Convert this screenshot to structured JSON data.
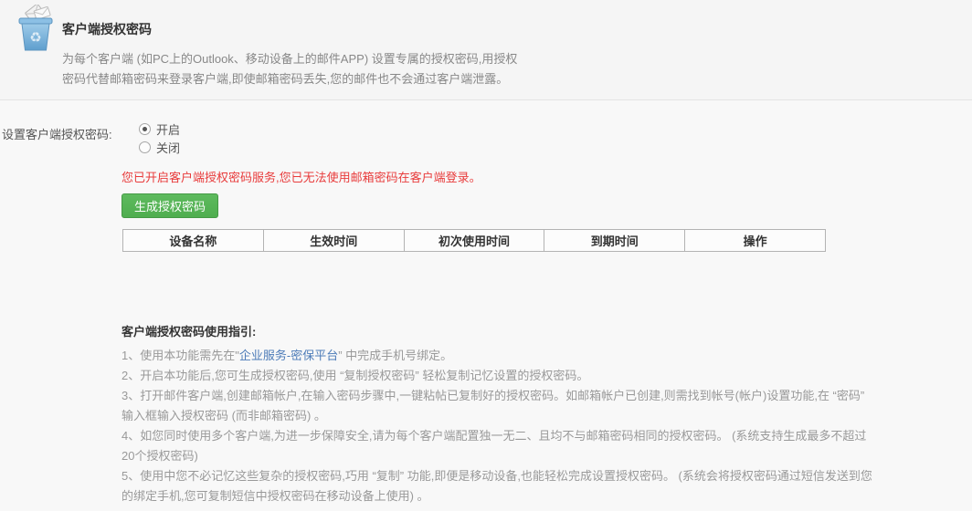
{
  "header": {
    "icon_name": "mail-trash-icon",
    "title": "客户端授权密码",
    "description_lines": [
      "为每个客户端 (如PC上的Outlook、移动设备上的邮件APP) 设置专属的授权密码,用授权",
      "密码代替邮箱密码来登录客户端,即使邮箱密码丢失,您的邮件也不会通过客户端泄露。"
    ]
  },
  "settings": {
    "label": "设置客户端授权密码:",
    "options": [
      {
        "label": "开启",
        "selected": true
      },
      {
        "label": "关闭",
        "selected": false
      }
    ],
    "warning": "您已开启客户端授权密码服务,您已无法使用邮箱密码在客户端登录。",
    "generate_button_label": "生成授权密码"
  },
  "password_table": {
    "headers": [
      "设备名称",
      "生效时间",
      "初次使用时间",
      "到期时间",
      "操作"
    ],
    "rows": []
  },
  "guide": {
    "title": "客户端授权密码使用指引:",
    "item1": {
      "prefix": "1、使用本功能需先在\"",
      "link_text": "企业服务-密保平台",
      "suffix": "” 中完成手机号绑定。"
    },
    "item2": "2、开启本功能后,您可生成授权密码,使用 “复制授权密码” 轻松复制记忆设置的授权密码。",
    "item3": "3、打开邮件客户端,创建邮箱帐户,在输入密码步骤中,一键粘帖已复制好的授权密码。如邮箱帐户已创建,则需找到帐号(帐户)设置功能,在 “密码” 输入框输入授权密码 (而非邮箱密码) 。",
    "item4": "4、如您同时使用多个客户端,为进一步保障安全,请为每个客户端配置独一无二、且均不与邮箱密码相同的授权密码。 (系统支持生成最多不超过20个授权密码)",
    "item5": "5、使用中您不必记忆这些复杂的授权密码,巧用 “复制” 功能,即便是移动设备,也能轻松完成设置授权密码。 (系统会将授权密码通过短信发送到您的绑定手机,您可复制短信中授权密码在移动设备上使用) 。"
  },
  "colors": {
    "accent_green": "#56b456",
    "warning_red": "#e83b3b",
    "link_blue": "#4d7cb8",
    "page_background": "#f8f8f8"
  }
}
